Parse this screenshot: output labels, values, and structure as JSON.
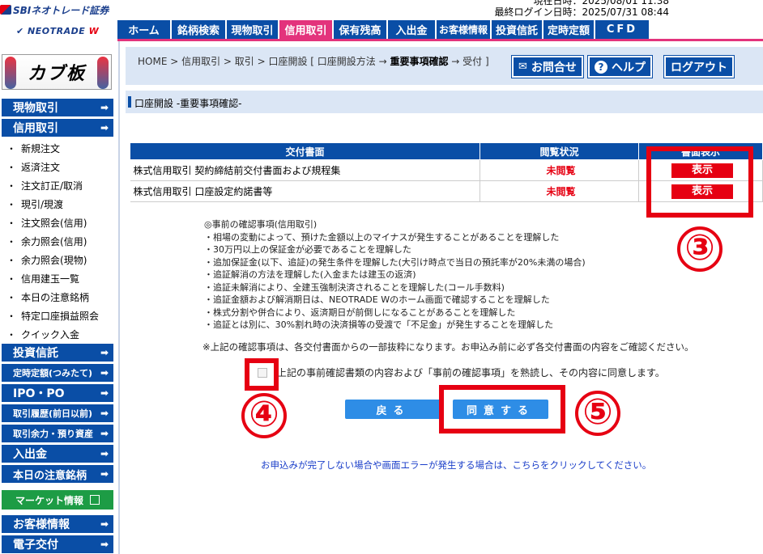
{
  "header": {
    "logo_sbi": "SBIネオトレード証券",
    "logo_neotrade": "NEOTRADE",
    "logo_neotrade_w": "W",
    "current_time": "現在日時：2025/08/01 11:38",
    "last_login": "最終ログイン日時：2025/07/31 08:44"
  },
  "topnav": [
    "ホーム",
    "銘柄検索",
    "現物取引",
    "信用取引",
    "保有残高",
    "入出金",
    "お客様情報",
    "投資信託",
    "定時定額",
    "CFD"
  ],
  "topnav_active": "信用取引",
  "sidebar": {
    "banner": "カブ板",
    "genbutsu": "現物取引",
    "shinyo": "信用取引",
    "sub_items": [
      "新規注文",
      "返済注文",
      "注文訂正/取消",
      "現引/現渡",
      "注文照会(信用)",
      "余力照会(信用)",
      "余力照会(現物)",
      "信用建玉一覧",
      "本日の注意銘柄",
      "特定口座損益照会",
      "クイック入金"
    ],
    "toushin": "投資信託",
    "teiji": "定時定額(つみたて)",
    "ipo": "IPO・PO",
    "rireki": "取引履歴(前日以前)",
    "yoryoku": "取引余力・預り資産",
    "nyushukkin": "入出金",
    "chui": "本日の注意銘柄",
    "market": "マーケット情報",
    "customer": "お客様情報",
    "denshi": "電子交付",
    "arrow": "➡"
  },
  "breadcrumb": {
    "prefix": "HOME > 信用取引 > 取引 > 口座開設 [ 口座開設方法 → ",
    "current": "重要事項確認",
    "suffix": " → 受付 ]"
  },
  "header_buttons": {
    "contact": "お問合せ",
    "help": "ヘルプ",
    "logout": "ログアウト"
  },
  "page_title": "口座開設 -重要事項確認-",
  "table": {
    "headers": [
      "交付書面",
      "閲覧状況",
      "書面表示"
    ],
    "rows": [
      {
        "doc": "株式信用取引 契約締結前交付書面および規程集",
        "status": "未閲覧",
        "action": "表示"
      },
      {
        "doc": "株式信用取引 口座設定約諾書等",
        "status": "未閲覧",
        "action": "表示"
      }
    ]
  },
  "notes": [
    "◎事前の確認事項(信用取引)",
    "・相場の変動によって、預けた金額以上のマイナスが発生することがあることを理解した",
    "・30万円以上の保証金が必要であることを理解した",
    "・追加保証金(以下、追証)の発生条件を理解した(大引け時点で当日の預託率が20%未満の場合)",
    "・追証解消の方法を理解した(入金または建玉の返済)",
    "・追証未解消により、全建玉強制決済されることを理解した(コール手数料)",
    "・追証金額および解消期日は、NEOTRADE Wのホーム画面で確認することを理解した",
    "・株式分割や併合により、返済期日が前倒しになることがあることを理解した",
    "・追証とは別に、30%割れ時の決済損等の受渡で「不足金」が発生することを理解した"
  ],
  "footnote": "※上記の確認事項は、各交付書面からの一部抜粋になります。お申込み前に必ず各交付書面の内容をご確認ください。",
  "agree_text": "上記の事前確認書類の内容および「事前の確認事項」を熟読し、その内容に同意します。",
  "buttons": {
    "back": "戻る",
    "agree": "同意する"
  },
  "help_link": "お申込みが完了しない場合や画面エラーが発生する場合は、こちらをクリックしてください。",
  "annotations": {
    "n3": "③",
    "n4": "④",
    "n5": "⑤"
  },
  "colors": {
    "nav_blue": "#0a4ea6",
    "active_pink": "#e3337c",
    "alert_red": "#e60012",
    "btn_blue": "#2e8de6",
    "market_green": "#1d9c45"
  }
}
